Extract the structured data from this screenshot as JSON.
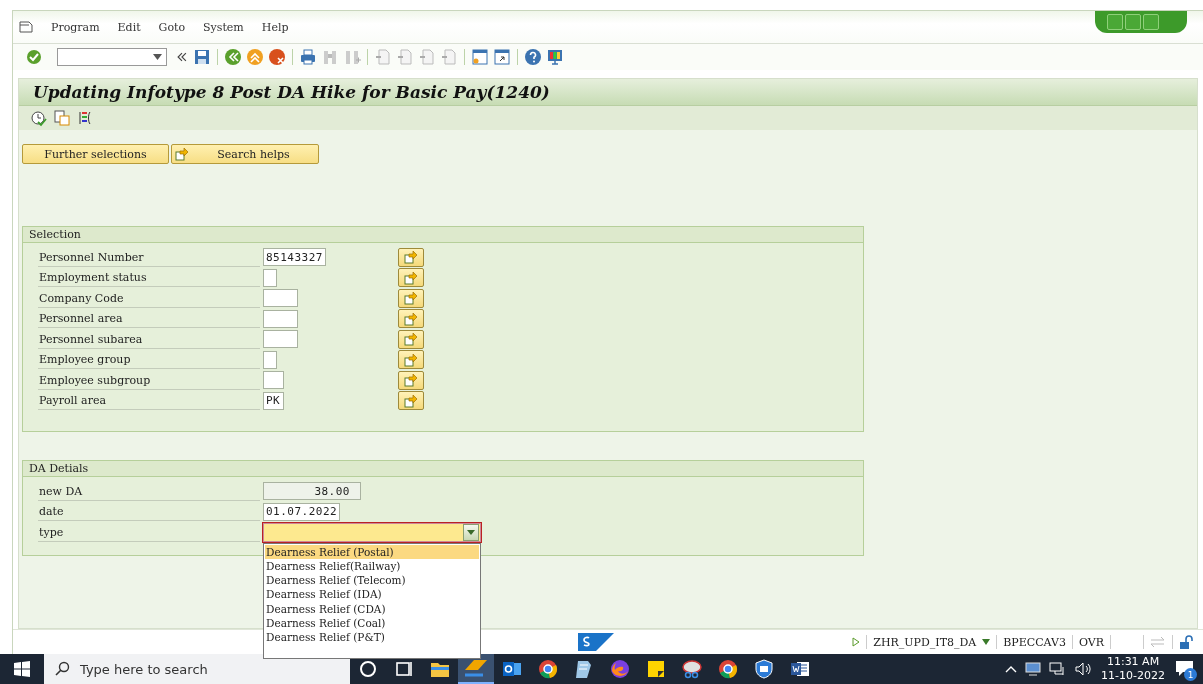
{
  "menu": [
    {
      "label": "Program"
    },
    {
      "label": "Edit"
    },
    {
      "label": "Goto"
    },
    {
      "label": "System"
    },
    {
      "label": "Help"
    }
  ],
  "title": "Updating Infotype 8 Post DA Hike for Basic Pay(1240)",
  "buttons": [
    {
      "label": "Further selections",
      "kind": "text"
    },
    {
      "label": "Search helps",
      "kind": "icon"
    }
  ],
  "selection": {
    "title": "Selection",
    "rows": [
      {
        "label": "Personnel Number",
        "value": "85143327",
        "kind": "long"
      },
      {
        "label": "Employment status",
        "kind": "single"
      },
      {
        "label": "Company Code",
        "kind": "medium"
      },
      {
        "label": "Personnel area",
        "kind": "medium"
      },
      {
        "label": "Personnel subarea",
        "kind": "medium"
      },
      {
        "label": "Employee group",
        "kind": "single"
      },
      {
        "label": "Employee subgroup",
        "kind": "short"
      },
      {
        "label": "Payroll area",
        "value": "PK",
        "kind": "short"
      }
    ]
  },
  "da_details": {
    "title": "DA Detials",
    "rows": [
      {
        "label": "new DA",
        "kind": "display",
        "value": "38.00"
      },
      {
        "label": "date",
        "kind": "input",
        "value": "01.07.2022"
      },
      {
        "label": "type",
        "kind": "dropdown",
        "expanded": true,
        "options": [
          {
            "label": "Dearness Relief (Postal)",
            "selected": true
          },
          {
            "label": "Dearness Relief(Railway)",
            "selected": false
          },
          {
            "label": "Dearness Relief (Telecom)",
            "selected": false
          },
          {
            "label": "Dearness Relief (IDA)",
            "selected": false
          },
          {
            "label": "Dearness Relief (CDA)",
            "selected": false
          },
          {
            "label": "Dearness Relief (Coal)",
            "selected": false
          },
          {
            "label": "Dearness Relief (P&T)",
            "selected": false
          }
        ]
      }
    ]
  },
  "status_bar": {
    "items": [
      "ZHR_UPD_IT8_DA",
      "BPECCAV3",
      "OVR"
    ]
  },
  "taskbar": {
    "search": {
      "placeholder": "Type here to search"
    },
    "apps": [
      {
        "kind": "cortana",
        "selected": false
      },
      {
        "kind": "taskview",
        "selected": false
      },
      {
        "kind": "folder",
        "selected": false
      },
      {
        "kind": "sap",
        "selected": true
      },
      {
        "kind": "mail",
        "selected": false
      },
      {
        "kind": "browser",
        "selected": false
      },
      {
        "kind": "notepad",
        "selected": false
      },
      {
        "kind": "fox",
        "selected": false
      },
      {
        "kind": "note",
        "selected": false
      },
      {
        "kind": "scissors",
        "selected": false
      },
      {
        "kind": "browser",
        "selected": false
      },
      {
        "kind": "shield",
        "selected": false
      },
      {
        "kind": "word",
        "selected": false
      }
    ],
    "time": "11:31 AM",
    "date": "11-10-2022",
    "notifications": "1"
  }
}
